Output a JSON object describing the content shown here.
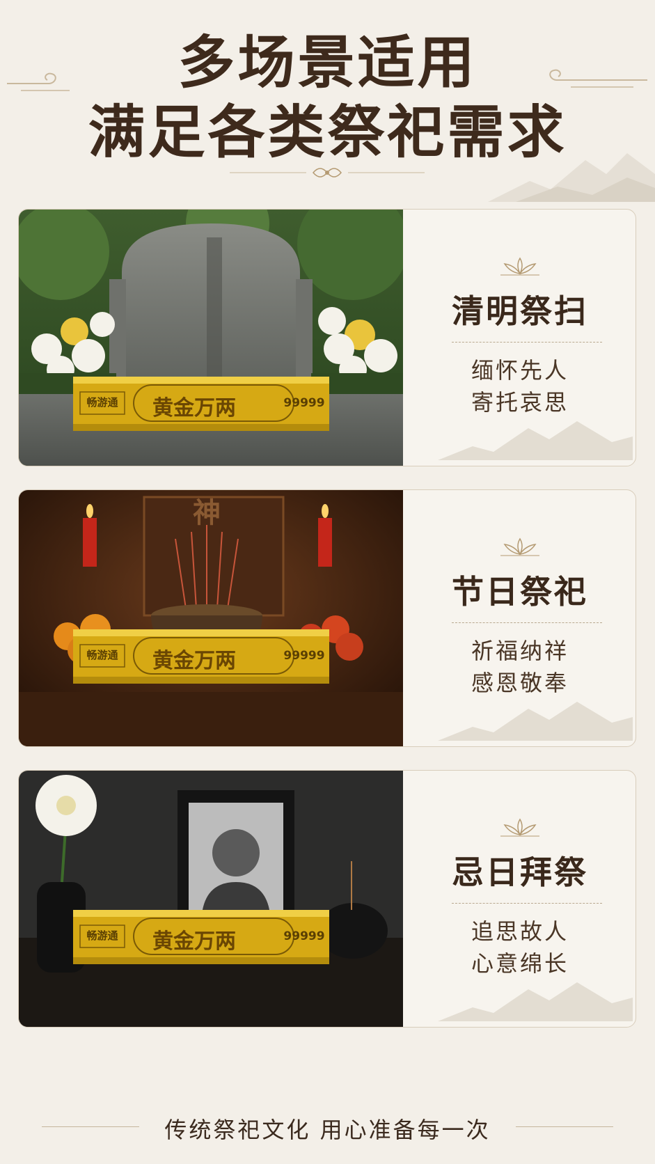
{
  "header": {
    "title_line1": "多场景适用",
    "title_line2": "满足各类祭祀需求"
  },
  "product": {
    "brand": "畅游通",
    "name": "黄金万两",
    "purity": "99999"
  },
  "scenes": [
    {
      "title": "清明祭扫",
      "line1": "缅怀先人",
      "line2": "寄托哀思",
      "photo": "tombstone-with-chrysanthemums"
    },
    {
      "title": "节日祭祀",
      "line1": "祈福纳祥",
      "line2": "感恩敬奉",
      "photo": "altar-with-candles-incense-fruit",
      "altar_char": "神"
    },
    {
      "title": "忌日拜祭",
      "line1": "追思故人",
      "line2": "心意绵长",
      "photo": "portrait-with-flower-and-incense"
    }
  ],
  "footer": {
    "text": "传统祭祀文化  用心准备每一次"
  },
  "colors": {
    "background": "#f3efe8",
    "title": "#3e2a1c",
    "gold": "#e3b91c"
  }
}
